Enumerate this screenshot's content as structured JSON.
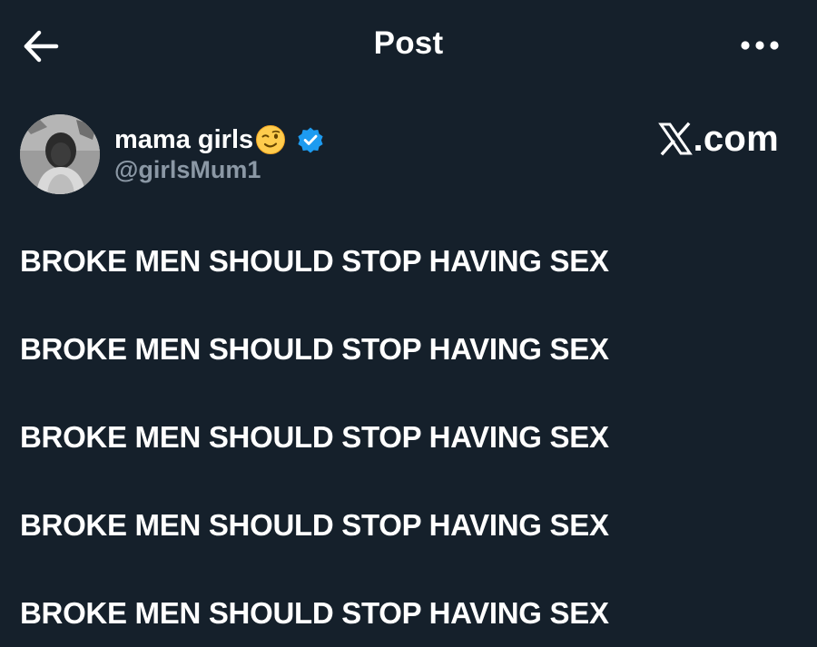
{
  "header": {
    "title": "Post",
    "back_icon": "arrow-left-icon",
    "more_icon": "more-horizontal-icon"
  },
  "author": {
    "display_name": "mama girls",
    "emoji": "winking-face",
    "verified_icon": "verified-badge-icon",
    "handle": "@girlsMum1"
  },
  "brand": {
    "logo_icon": "x-logo-icon",
    "text": ".com"
  },
  "post": {
    "lines": [
      "BROKE MEN SHOULD STOP HAVING SEX",
      "BROKE MEN SHOULD STOP HAVING SEX",
      "BROKE MEN SHOULD STOP HAVING SEX",
      "BROKE MEN SHOULD STOP HAVING SEX",
      "BROKE MEN SHOULD STOP HAVING SEX"
    ]
  },
  "colors": {
    "background": "#15202b",
    "text_primary": "#ffffff",
    "text_secondary": "#8b98a5",
    "verified_blue": "#1d9bf0"
  }
}
